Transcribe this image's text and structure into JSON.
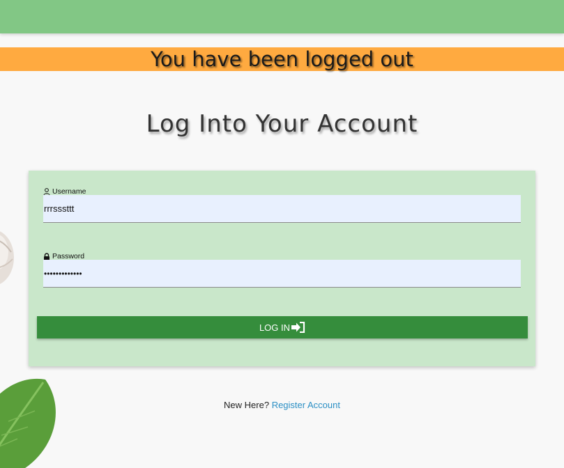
{
  "colors": {
    "top_bar": "#82c785",
    "alert_bar": "#ffaa40",
    "card_bg": "#c9e7ca",
    "input_bg": "#e8f0fe",
    "button_bg": "#358d3c",
    "link": "#2b8fc4"
  },
  "alert": {
    "message": "You have been logged out"
  },
  "page": {
    "title": "Log Into Your Account"
  },
  "form": {
    "username": {
      "label": "Username",
      "icon": "user-icon",
      "value": "rrrsssttt"
    },
    "password": {
      "label": "Password",
      "icon": "lock-icon",
      "value": "•••••••••••••"
    },
    "submit": {
      "label": "LOG IN",
      "icon": "sign-in-icon"
    }
  },
  "footer": {
    "prompt": "New Here?",
    "register_link": "Register Account"
  }
}
